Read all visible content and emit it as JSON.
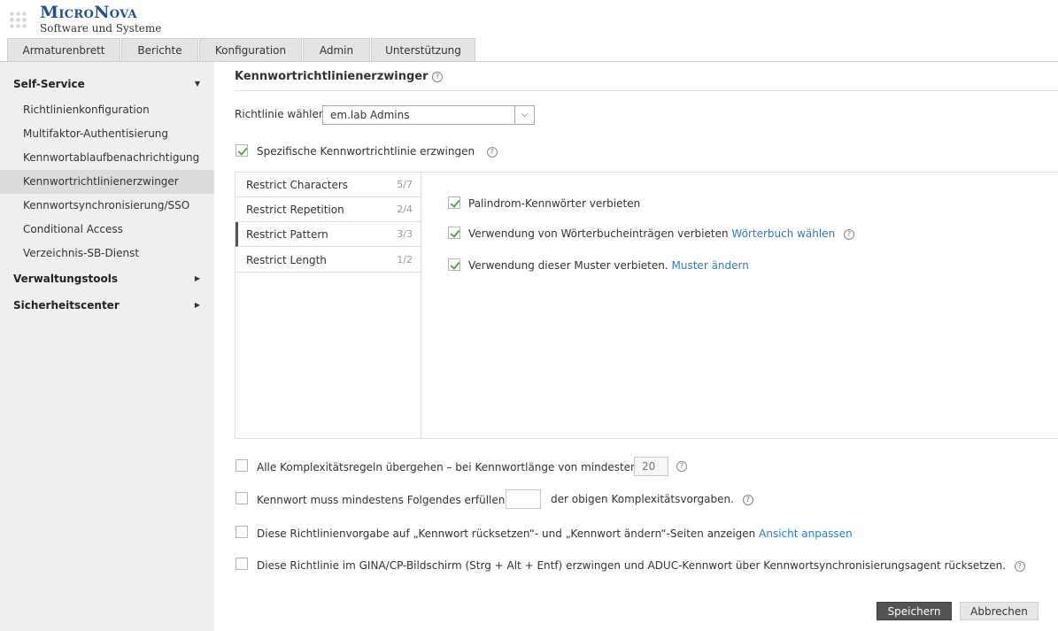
{
  "brand": {
    "title": "MicroNova",
    "subtitle": "Software und Systeme"
  },
  "tabs": [
    "Armaturenbrett",
    "Berichte",
    "Konfiguration",
    "Admin",
    "Unterstützung"
  ],
  "sidebar": {
    "sections": [
      {
        "label": "Self-Service",
        "expanded": true
      },
      {
        "label": "Verwaltungstools",
        "expanded": false
      },
      {
        "label": "Sicherheitscenter",
        "expanded": false
      }
    ],
    "items": [
      {
        "label": "Richtlinienkonfiguration"
      },
      {
        "label": "Multifaktor-Authentisierung"
      },
      {
        "label": "Kennwortablaufbenachrichtigung"
      },
      {
        "label": "Kennwortrichtlinienerzwinger",
        "active": true
      },
      {
        "label": "Kennwortsynchronisierung/SSO"
      },
      {
        "label": "Conditional Access"
      },
      {
        "label": "Verzeichnis-SB-Dienst"
      }
    ]
  },
  "main": {
    "title": "Kennwortrichtlinienerzwinger",
    "policy_label": "Richtlinie wählen",
    "policy_value": "em.lab Admins",
    "enforce_label": "Spezifische Kennwortrichtlinie erzwingen",
    "enforce_checked": true,
    "rules": [
      {
        "label": "Restrict Characters",
        "count": "5/7"
      },
      {
        "label": "Restrict Repetition",
        "count": "2/4"
      },
      {
        "label": "Restrict Pattern",
        "count": "3/3",
        "active": true
      },
      {
        "label": "Restrict Length",
        "count": "1/2"
      }
    ],
    "pattern_options": [
      {
        "label": "Palindrom-Kennwörter verbieten",
        "link": "",
        "checked": true
      },
      {
        "label": "Verwendung von Wörterbucheinträgen verbieten",
        "link": "Wörterbuch wählen",
        "checked": true
      },
      {
        "label": "Verwendung dieser Muster verbieten.",
        "link": "Muster ändern",
        "checked": true
      }
    ],
    "bottom_options": {
      "opt1_label": "Alle Komplexitätsregeln übergehen – bei Kennwortlänge von mindestens",
      "opt1_value": "20",
      "opt2_label": "Kennwort muss mindestens Folgendes erfüllen –",
      "opt2_suffix": "der obigen Komplexitätsvorgaben.",
      "opt3_label": "Diese Richtlinienvorgabe auf „Kennwort rücksetzen“- und „Kennwort ändern“-Seiten anzeigen",
      "opt3_link": "Ansicht anpassen",
      "opt4_label": "Diese Richtlinie im GINA/CP-Bildschirm (Strg + Alt + Entf) erzwingen und ADUC-Kennwort über Kennwortsynchronisierungsagent rücksetzen."
    },
    "buttons": {
      "save": "Speichern",
      "cancel": "Abbrechen"
    }
  }
}
